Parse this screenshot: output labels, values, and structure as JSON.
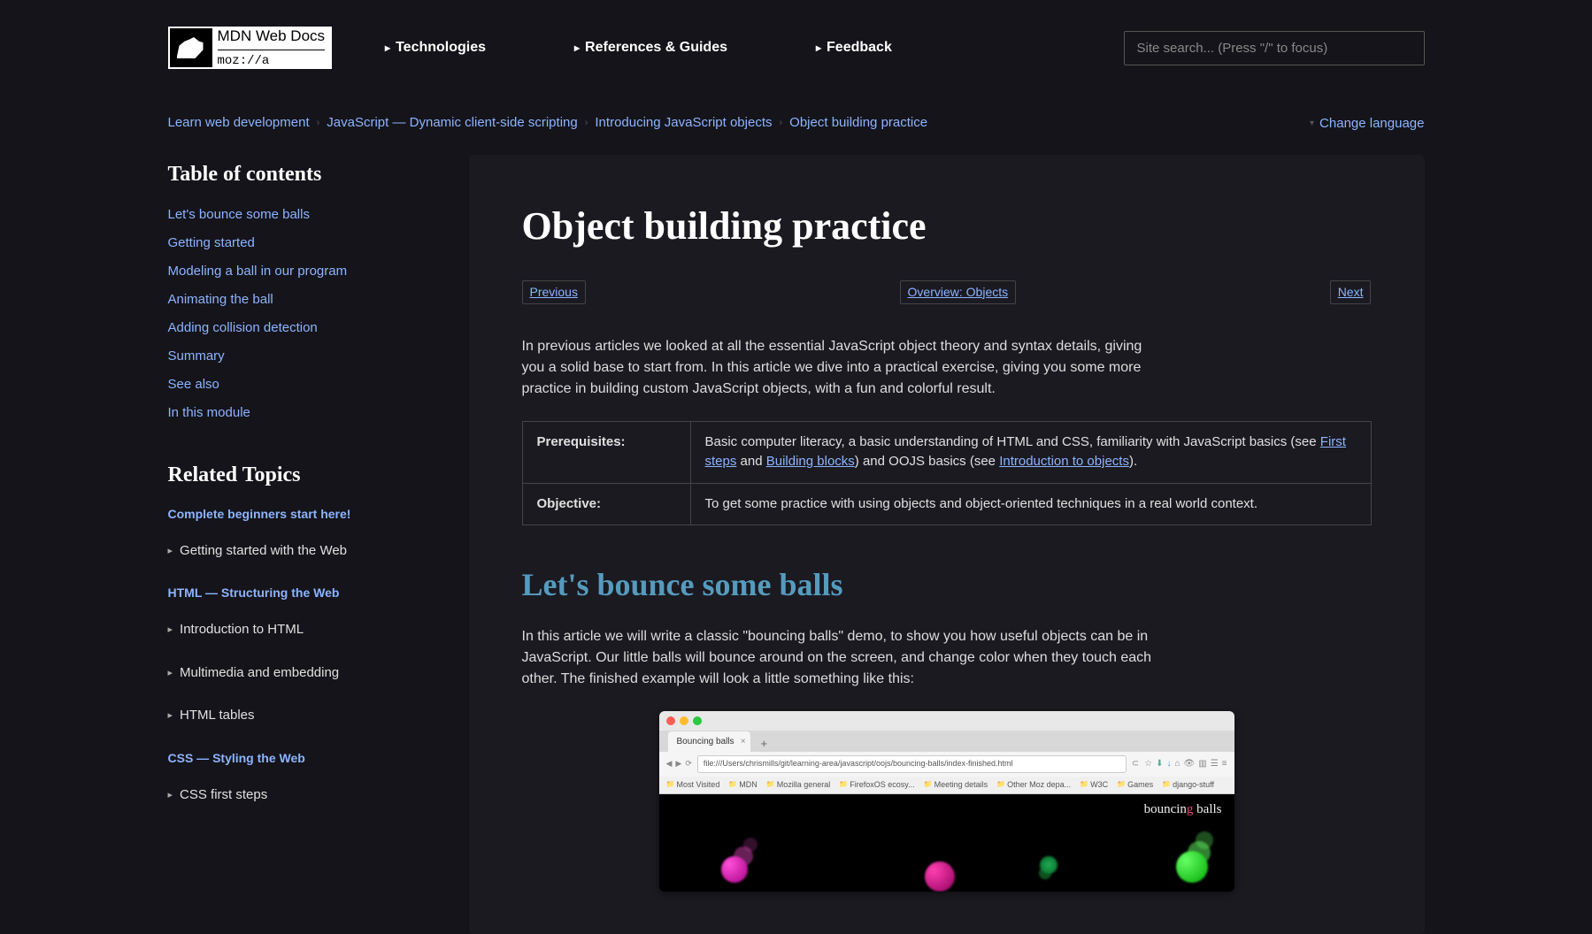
{
  "header": {
    "logo_top": "MDN Web Docs",
    "logo_bottom": "moz://a",
    "nav": [
      "Technologies",
      "References & Guides",
      "Feedback"
    ],
    "search_placeholder": "Site search... (Press \"/\" to focus)"
  },
  "breadcrumb": [
    "Learn web development",
    "JavaScript — Dynamic client-side scripting",
    "Introducing JavaScript objects",
    "Object building practice"
  ],
  "change_language": "Change language",
  "toc": {
    "heading": "Table of contents",
    "items": [
      "Let's bounce some balls",
      "Getting started",
      "Modeling a ball in our program",
      "Animating the ball",
      "Adding collision detection",
      "Summary",
      "See also",
      "In this module"
    ]
  },
  "related": {
    "heading": "Related Topics",
    "groups": [
      {
        "title": "Complete beginners start here!",
        "items": [
          "Getting started with the Web"
        ]
      },
      {
        "title": "HTML — Structuring the Web",
        "items": [
          "Introduction to HTML",
          "Multimedia and embedding",
          "HTML tables"
        ]
      },
      {
        "title": "CSS — Styling the Web",
        "items": [
          "CSS first steps"
        ]
      }
    ]
  },
  "article": {
    "title": "Object building practice",
    "pager": {
      "prev": "Previous",
      "overview": "Overview: Objects",
      "next": "Next"
    },
    "intro": "In previous articles we looked at all the essential JavaScript object theory and syntax details, giving you a solid base to start from. In this article we dive into a practical exercise, giving you some more practice in building custom JavaScript objects, with a fun and colorful result.",
    "prereq_label": "Prerequisites:",
    "prereq_text_1": "Basic computer literacy, a basic understanding of HTML and CSS, familiarity with JavaScript basics (see ",
    "prereq_link_1": "First steps",
    "prereq_and": " and ",
    "prereq_link_2": "Building blocks",
    "prereq_text_2": ") and OOJS basics (see ",
    "prereq_link_3": "Introduction to objects",
    "prereq_text_3": ").",
    "objective_label": "Objective:",
    "objective_text": "To get some practice with using objects and object-oriented techniques in a real world context.",
    "h2": "Let's bounce some balls",
    "body1": "In this article we will write a classic \"bouncing balls\" demo, to show you how useful objects can be in JavaScript. Our little balls will bounce around on the screen, and change color when they touch each other. The finished example will look a little something like this:"
  },
  "demo": {
    "tab": "Bouncing balls",
    "url": "file:///Users/chrismills/git/learning-area/javascript/oojs/bouncing-balls/index-finished.html",
    "bookmarks": [
      "Most Visited",
      "MDN",
      "Mozilla general",
      "FirefoxOS ecosy...",
      "Meeting details",
      "Other Moz depa...",
      "W3C",
      "Games",
      "django-stuff"
    ],
    "canvas_title_1": "bouncin",
    "canvas_title_2": "g",
    "canvas_title_3": " balls"
  }
}
